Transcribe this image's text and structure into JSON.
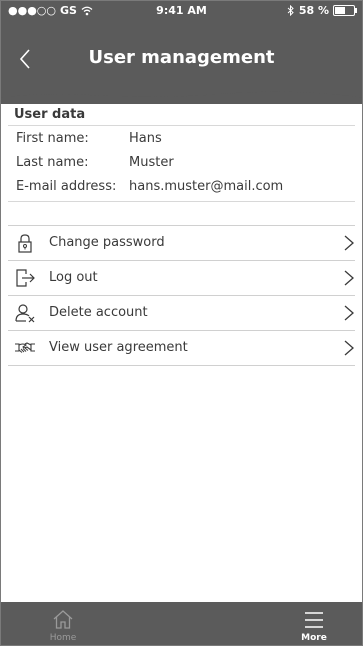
{
  "status_bar": {
    "signal": "●●●○○",
    "carrier": "GS",
    "time": "9:41 AM",
    "battery": "58 %",
    "battery_level": 0.58
  },
  "header": {
    "title": "User management"
  },
  "user_data": {
    "section_title": "User data",
    "fields": [
      {
        "label": "First name:",
        "value": "Hans"
      },
      {
        "label": "Last name:",
        "value": "Muster"
      },
      {
        "label": "E-mail address:",
        "value": "hans.muster@mail.com"
      }
    ]
  },
  "menu": {
    "items": [
      {
        "label": "Change password",
        "icon": "padlock-icon"
      },
      {
        "label": "Log out",
        "icon": "logout-icon"
      },
      {
        "label": "Delete account",
        "icon": "delete-user-icon"
      },
      {
        "label": "View user agreement",
        "icon": "handshake-icon"
      }
    ]
  },
  "tabbar": {
    "tabs": [
      {
        "label": "Home",
        "icon": "home-icon",
        "active": false
      },
      {
        "label": "More",
        "icon": "menu-icon",
        "active": true
      }
    ]
  },
  "colors": {
    "header_bg": "#5b5b5b",
    "text": "#3a3a3a",
    "divider": "#d0d0d0",
    "inactive_tab": "#9a9a9a"
  }
}
